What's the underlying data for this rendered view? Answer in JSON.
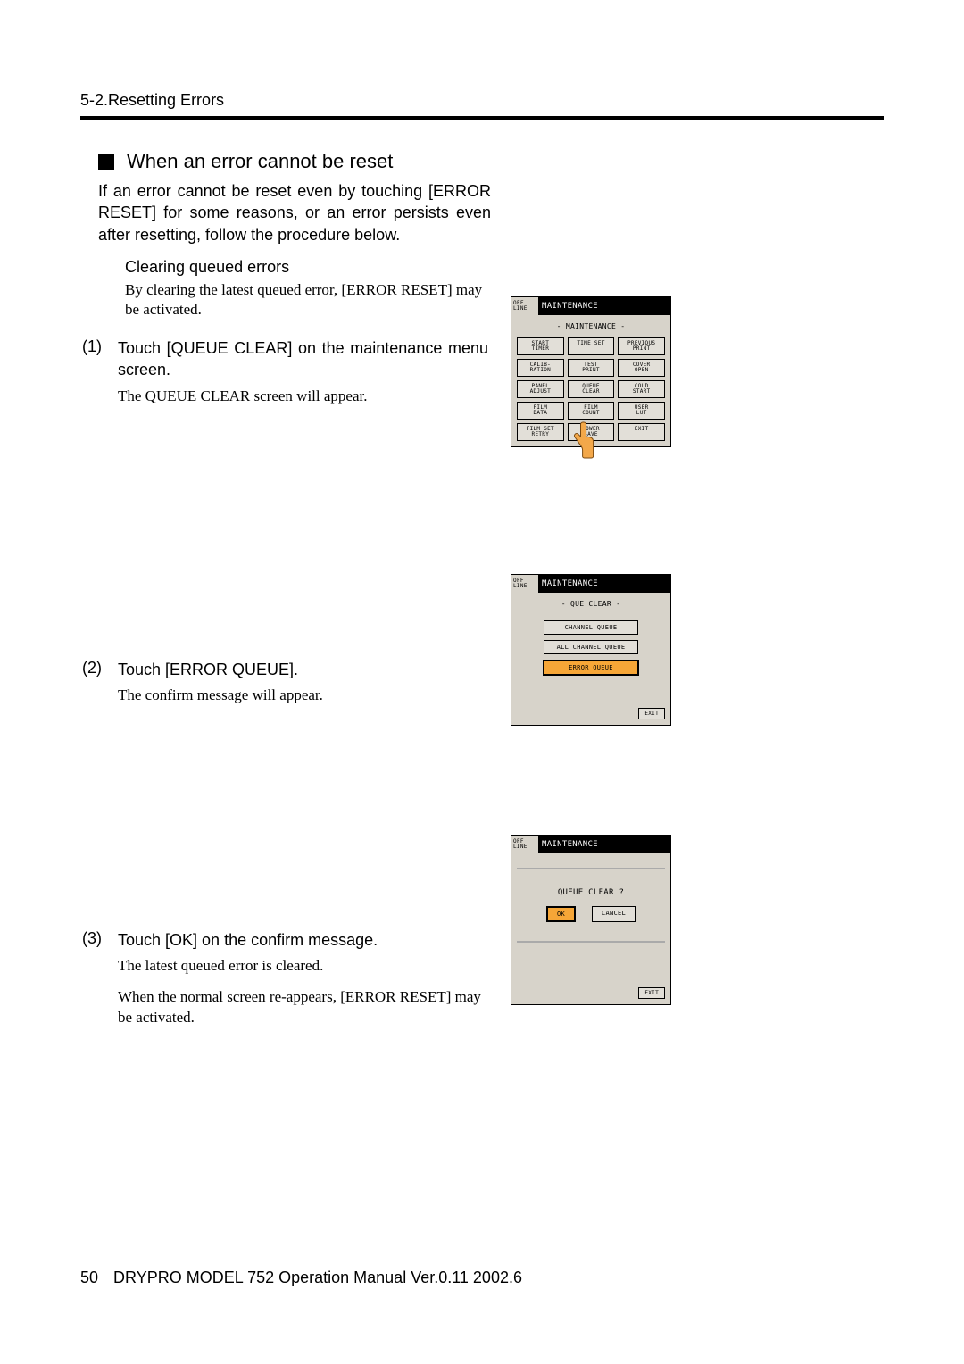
{
  "header": {
    "section": "5-2.Resetting Errors"
  },
  "heading": "When an error cannot be reset",
  "intro": "If an error cannot be reset even by touching [ERROR RESET] for some reasons, or an error persists even after resetting, follow the procedure below.",
  "sub": {
    "title": "Clearing queued errors",
    "body": "By clearing the latest queued error, [ERROR RESET] may be activated."
  },
  "steps": [
    {
      "num": "(1)",
      "text": "Touch [QUEUE CLEAR] on the maintenance menu screen.",
      "note": "The QUEUE CLEAR screen will appear."
    },
    {
      "num": "(2)",
      "text": "Touch [ERROR QUEUE].",
      "note": "The confirm message will appear."
    },
    {
      "num": "(3)",
      "text": "Touch [OK] on the confirm message.",
      "note": "The latest queued error is cleared.",
      "note2": "When the normal screen re-appears, [ERROR RESET] may be activated."
    }
  ],
  "footer": {
    "page": "50",
    "title": "DRYPRO MODEL 752 Operation Manual Ver.0.11 2002.6"
  },
  "screen_common": {
    "status1": "OFF",
    "status2": "LINE",
    "title": "MAINTENANCE",
    "exit": "EXIT"
  },
  "screen1": {
    "subtitle": "- MAINTENANCE -",
    "buttons": [
      "START\nTIMER",
      "TIME SET",
      "PREVIOUS\nPRINT",
      "CALIB-\nRATION",
      "TEST\nPRINT",
      "COVER\nOPEN",
      "PANEL\nADJUST",
      "QUEUE\nCLEAR",
      "COLD\nSTART",
      "FILM\nDATA",
      "FILM\nCOUNT",
      "USER\nLUT",
      "FILM SET\nRETRY",
      "POWER\nSAVE",
      "EXIT"
    ]
  },
  "screen2": {
    "subtitle": "- QUE CLEAR -",
    "items": [
      "CHANNEL QUEUE",
      "ALL CHANNEL QUEUE",
      "ERROR QUEUE"
    ]
  },
  "screen3": {
    "question": "QUEUE CLEAR ?",
    "ok": "OK",
    "cancel": "CANCEL"
  }
}
